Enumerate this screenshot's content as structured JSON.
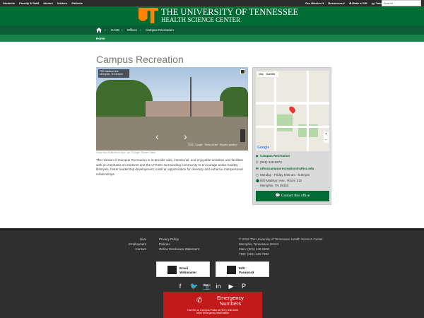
{
  "topbar": {
    "audience": [
      "Students",
      "Faculty & Staff",
      "Alumni",
      "Visitors",
      "Patients"
    ],
    "utility": [
      "Our Mission ▾",
      "Resources ▾",
      "✚ Make a Gift",
      "🚌 Take a Tour"
    ],
    "search_placeholder": "Search"
  },
  "header": {
    "line1": "THE UNIVERSITY OF TENNESSEE",
    "line2": "HEALTH SCIENCE CENTER"
  },
  "breadcrumb": {
    "items": [
      "CASE",
      "Offices",
      "Campus Recreation"
    ]
  },
  "subnav": {
    "home": "Home"
  },
  "page": {
    "title": "Campus Recreation",
    "caption": "View from Madison Ave. on Google Street View",
    "description": "The mission of Campus Recreation is to provide safe, intentional, and enjoyable activities and facilities with an emphasis on students and the UTHSC surrounding community to encourage active healthy lifestyles, foster leadership development, instill an appreciation for diversity and enhance interpersonal relationships."
  },
  "streetview": {
    "label": "709 Madison Ave",
    "sub": "Memphis, Tennessee",
    "footer": "©2017 Google · Terms of Use · Report a problem"
  },
  "map": {
    "tabs": [
      "Map",
      "Satellite"
    ],
    "logo": "Google"
  },
  "office": {
    "name": "Campus Recreation",
    "phone": "(901) 448-5973",
    "email": "uthsccampusrecreation@uthsc.edu",
    "hours": "Monday - Friday 8:00 am - 5:00 pm",
    "address1": "800 Madison Ave., Room 212",
    "address2": "Memphis, TN 38163",
    "contact_label": "Contact this office"
  },
  "footer": {
    "col1": [
      "Give",
      "Employment",
      "Contact"
    ],
    "col2": [
      "Privacy Policy",
      "Policies",
      "Online Disclosure Statement"
    ],
    "col3": [
      "© 2016 The University of Tennessee Health Science Center",
      "Memphis, Tennessee 38163",
      "Main: (901) 448-5500",
      "TDD: (901) 448-7382"
    ],
    "email_btn": [
      "Email",
      "Webmaster"
    ],
    "edit_btn": [
      "Edit",
      "Password"
    ],
    "social": [
      "f",
      "🐦",
      "📷",
      "in",
      "▶",
      "P"
    ],
    "emergency_title": [
      "Emergency",
      "Numbers"
    ],
    "emergency_sub1": "Call 911 or Campus Police at (901) 448-4444",
    "emergency_sub2": "More Emergency Information"
  }
}
